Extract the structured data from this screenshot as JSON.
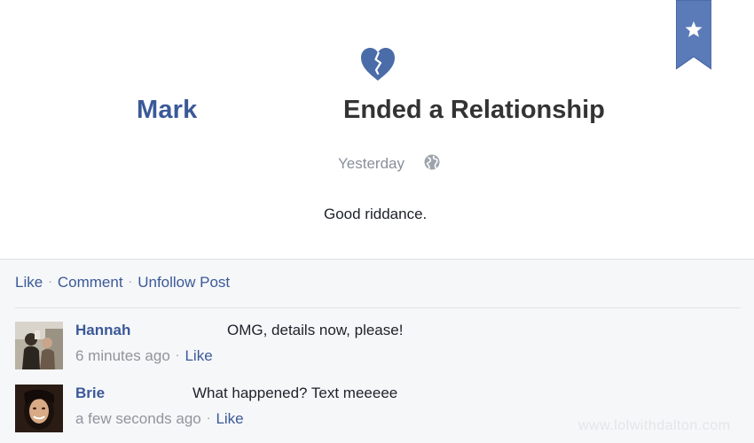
{
  "post": {
    "actor": "Mark",
    "event": "Ended a Relationship",
    "time": "Yesterday",
    "status_text": "Good riddance."
  },
  "actions": {
    "like": "Like",
    "separator": "·",
    "comment": "Comment",
    "unfollow": "Unfollow Post"
  },
  "comments": [
    {
      "name": "Hannah",
      "text": "OMG, details now, please!",
      "time": "6 minutes ago",
      "like": "Like"
    },
    {
      "name": "Brie",
      "text": "What happened? Text meeeee",
      "time": "a few seconds ago",
      "like": "Like"
    }
  ],
  "watermark": "www.lolwithdalton.com",
  "colors": {
    "accent": "#3b5998",
    "muted": "#898f9c",
    "text": "#333333",
    "footer_bg": "#f6f7f9",
    "heart": "#4a6ca8"
  },
  "icons": {
    "bookmark": "star-bookmark-icon",
    "event": "broken-heart-icon",
    "privacy": "globe-icon"
  }
}
